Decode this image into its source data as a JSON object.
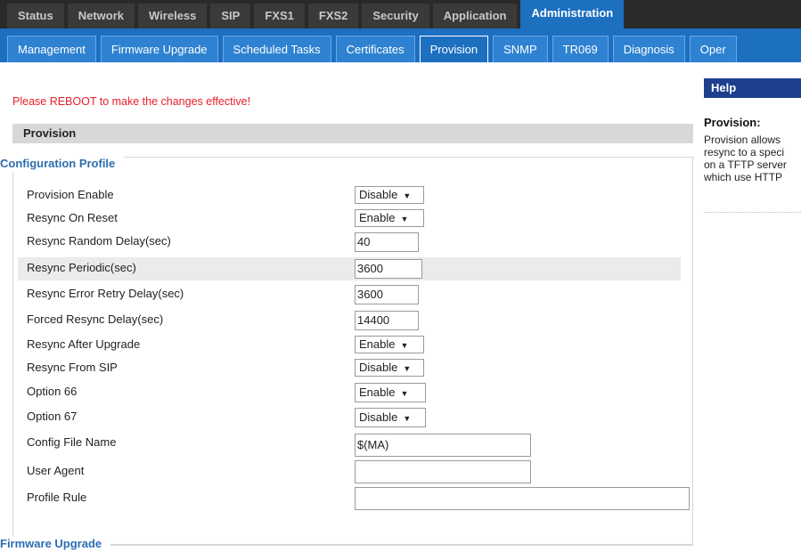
{
  "top_tabs": [
    "Status",
    "Network",
    "Wireless",
    "SIP",
    "FXS1",
    "FXS2",
    "Security",
    "Application",
    "Administration"
  ],
  "sub_tabs": [
    "Management",
    "Firmware Upgrade",
    "Scheduled Tasks",
    "Certificates",
    "Provision",
    "SNMP",
    "TR069",
    "Diagnosis",
    "Oper"
  ],
  "reboot_message": "Please REBOOT to make the changes effective!",
  "section_title": "Provision",
  "config_legend": "Configuration Profile",
  "fields": {
    "provision_enable": {
      "label": "Provision Enable",
      "value": "Disable"
    },
    "resync_on_reset": {
      "label": "Resync On Reset",
      "value": "Enable"
    },
    "resync_random_delay": {
      "label": "Resync Random Delay(sec)",
      "value": "40"
    },
    "resync_periodic": {
      "label": "Resync Periodic(sec)",
      "value": "3600"
    },
    "resync_error_retry": {
      "label": "Resync Error Retry Delay(sec)",
      "value": "3600"
    },
    "forced_resync_delay": {
      "label": "Forced Resync Delay(sec)",
      "value": "14400"
    },
    "resync_after_upgrade": {
      "label": "Resync After Upgrade",
      "value": "Enable"
    },
    "resync_from_sip": {
      "label": "Resync From SIP",
      "value": "Disable"
    },
    "option_66": {
      "label": "Option 66",
      "value": "Enable"
    },
    "option_67": {
      "label": "Option 67",
      "value": "Disable"
    },
    "config_file_name": {
      "label": "Config File Name",
      "value": "$(MA)"
    },
    "user_agent": {
      "label": "User Agent",
      "value": ""
    },
    "profile_rule": {
      "label": "Profile Rule",
      "value": ""
    }
  },
  "firmware_legend": "Firmware Upgrade",
  "help": {
    "title": "Help",
    "heading": "Provision:",
    "lines": [
      "Provision allows",
      "resync to a speci",
      "on a TFTP server",
      "which use HTTP"
    ]
  },
  "icons": {
    "dropdown_arrow": "▼"
  }
}
